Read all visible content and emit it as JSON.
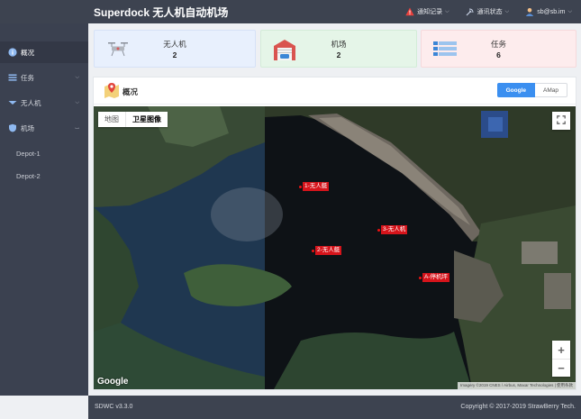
{
  "header": {
    "title": "Superdock 无人机自动机场",
    "nav": [
      {
        "label": "通知记录",
        "icon": "warning-icon"
      },
      {
        "label": "通讯状态",
        "icon": "antenna-icon"
      },
      {
        "label": "sb@sb.im",
        "icon": "user-icon"
      }
    ]
  },
  "sidebar": {
    "items": [
      {
        "label": "概况",
        "icon": "info-icon"
      },
      {
        "label": "任务",
        "icon": "list-icon"
      },
      {
        "label": "无人机",
        "icon": "plane-icon"
      },
      {
        "label": "机场",
        "icon": "shield-icon"
      }
    ],
    "sub_items": [
      "Depot-1",
      "Depot-2"
    ]
  },
  "stats": {
    "drone": {
      "label": "无人机",
      "value": "2"
    },
    "depot": {
      "label": "机场",
      "value": "2"
    },
    "task": {
      "label": "任务",
      "value": "6"
    }
  },
  "overview": {
    "title": "概况",
    "map_provider_options": [
      "Google",
      "AMap"
    ],
    "selected_provider": "Google"
  },
  "map": {
    "type_options": [
      "地图",
      "卫星图像"
    ],
    "selected_type": "卫星图像",
    "markers": [
      "1-无人艇",
      "2-无人艇",
      "3-无人机",
      "A-停机坪"
    ],
    "logo": "Google",
    "attribution": "Imagery ©2019 CNES / Airbus, Maxar Technologies | 使用条款",
    "zoom_in": "+",
    "zoom_out": "−"
  },
  "footer": {
    "version": "SDWC v3.3.0",
    "copyright": "Copyright © 2017-2019 StrawBerry Tech."
  },
  "colors": {
    "header_bg": "#3d4350",
    "sidebar_bg": "#3b4150",
    "accent": "#3b8ff0",
    "marker": "#d6141b"
  }
}
